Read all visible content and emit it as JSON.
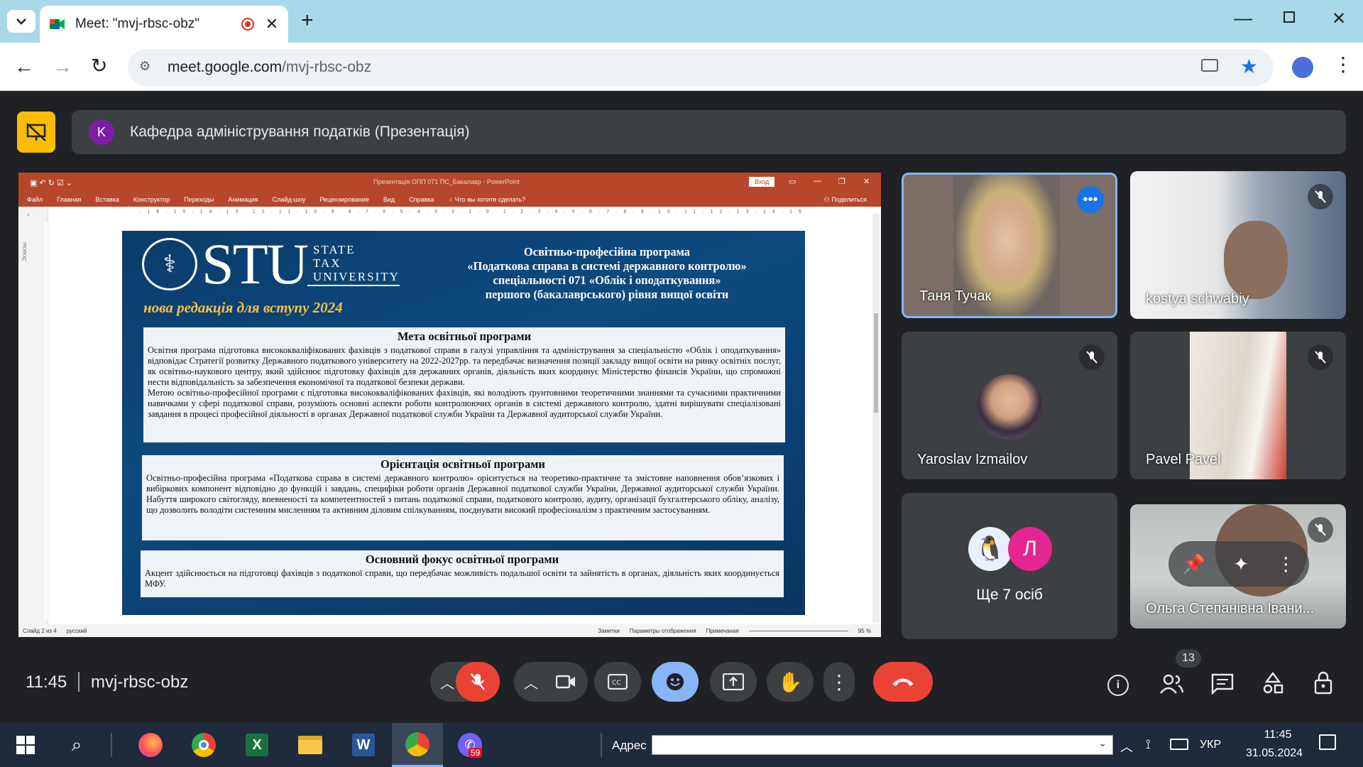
{
  "browser": {
    "tab_title": "Meet: \"mvj-rbsc-obz\"",
    "url_host": "meet.google.com",
    "url_path": "/mvj-rbsc-obz"
  },
  "meeting": {
    "presentation_initial": "K",
    "presentation_title": "Кафедра адміністрування податків (Презентація)",
    "time": "11:45",
    "code": "mvj-rbsc-obz",
    "participants_count": "13"
  },
  "powerpoint": {
    "window_title": "Презентація ОПП 071 ПС_Бакалавр - PowerPoint",
    "login_label": "Вход",
    "ribbon": [
      "Файл",
      "Главная",
      "Вставка",
      "Конструктор",
      "Переходы",
      "Анимация",
      "Слайд-шоу",
      "Рецензирование",
      "Вид",
      "Справка"
    ],
    "tell_me": "Что вы хотите сделать?",
    "share": "Поделиться",
    "side_label": "Эскизы",
    "status_slide": "Слайд 2 из 4",
    "status_lang": "русский",
    "status_notes": "Заметки",
    "status_display": "Параметры отображения",
    "status_comments": "Примечания",
    "status_zoom": "95 %"
  },
  "slide": {
    "logo_big": "STU",
    "logo_line1": "STATE",
    "logo_line2": "TAX",
    "logo_line3": "UNIVERSITY",
    "tagline": "нова редакція для вступу 2024",
    "title_l1": "Освітньо-професійна програма",
    "title_l2": "«Податкова справа в системі державного контролю»",
    "title_l3": "спеціальності 071 «Облік і оподаткування»",
    "title_l4": "першого (бакалаврського) рівня вищої освіти",
    "box1_heading": "Мета освітньої програми",
    "box1_text": "Освітня програма підготовка висококваліфікованих фахівців з податкової справи в галузі управління та адміністрування за спеціальністю «Облік і оподаткування» відповідає Стратегії розвитку Державного податкового університету на 2022-2027рр. та передбачає визначення позиції закладу вищої освіти на ринку освітніх послуг, як освітньо-наукового центру, який здійснює підготовку фахівців для державних органів, діяльність яких координує Міністерство фінансів України, що спроможні нести відповідальність за забезпечення економічної та податкової безпеки держави.",
    "box1_text2": "Метою освітньо-професійної програми є підготовка висококваліфікованих фахівців, які володіють ґрунтовними теоретичними знаннями та сучасними практичними навичками у сфері податкової справи, розуміють основні аспекти роботи контролюючих органів в системі державного контролю, здатні вирішувати спеціалізовані завдання в процесі професійної діяльності в органах Державної податкової служби України та Державної аудиторської служби України.",
    "box2_heading": "Орієнтація освітньої програми",
    "box2_text": "Освітньо-професійна програма «Податкова справа в системі державного контролю» орієнтується на теоретико-практичне та змістовне наповнення обов’язкових і вибіркових компонент відповідно до функцій і завдань, специфіки роботи органів Державної податкової служби України, Державної аудиторської служби України. Набуття широкого світогляду, впевненості та компетентностей з питань податкової справи, податкового контролю, аудиту, організації бухгалтерського обліку, аналізу, що дозволить володіти системним мисленням та активним діловим спілкуванням, поєднувати високий професіоналізм з практичним застосуванням.",
    "box3_heading": "Основний фокус освітньої програми",
    "box3_text": "Акцент здійснюється на підготовці фахівців з податкової справи, що передбачає можливість подальшої освіти та зайнятість в органах, діяльність яких координується МФУ."
  },
  "participants": [
    {
      "name": "Таня Тучак"
    },
    {
      "name": "kostya schwabiy"
    },
    {
      "name": "Yaroslav Izmailov"
    },
    {
      "name": "Pavel Pavel"
    },
    {
      "name": "Ще 7 осіб",
      "avatar_letter": "Л"
    },
    {
      "name": "Ольга Степанівна Івани..."
    }
  ],
  "taskbar": {
    "address_label": "Адрес",
    "lang": "УКР",
    "time": "11:45",
    "date": "31.05.2024",
    "viber_badge": "59"
  }
}
